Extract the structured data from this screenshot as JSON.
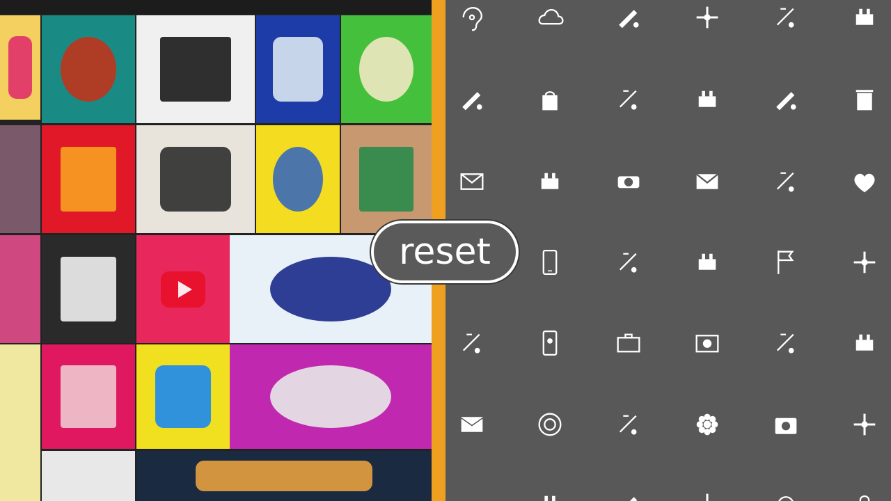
{
  "reset_button": {
    "label": "reset"
  },
  "collage": {
    "tiles": [
      {
        "name": "collage-tile-pink-bars",
        "bg": "#f4d060",
        "accent": "#e0306a"
      },
      {
        "name": "collage-tile-teal-device",
        "bg": "#1a8a84",
        "accent": "#c0341c"
      },
      {
        "name": "collage-tile-tea-cup",
        "bg": "#f0f0f0",
        "accent": "#1a1a1a"
      },
      {
        "name": "collage-tile-blue-box",
        "bg": "#1e3ca8",
        "accent": "#d8e6f0"
      },
      {
        "name": "collage-tile-green-box",
        "bg": "#44c03c",
        "accent": "#f0e8c0"
      },
      {
        "name": "collage-tile-red-package",
        "bg": "#e01828",
        "accent": "#f8a020"
      },
      {
        "name": "collage-tile-sketch",
        "bg": "#e8e4dc",
        "accent": "#2e2e2e"
      },
      {
        "name": "collage-tile-yellow-vase",
        "bg": "#f4dc20",
        "accent": "#3a6ab8"
      },
      {
        "name": "collage-tile-ornate-figure",
        "bg": "#c89870",
        "accent": "#2a8a4a"
      },
      {
        "name": "collage-tile-youtube-logo",
        "bg": "#e8285c",
        "accent": "#ffffff"
      },
      {
        "name": "collage-tile-poster-text",
        "bg": "#e8f0f8",
        "accent": "#1a2a8a"
      },
      {
        "name": "collage-tile-dark-bag",
        "bg": "#2a2a2a",
        "accent": "#f0f0f0"
      },
      {
        "name": "collage-tile-yellow-drop",
        "bg": "#f0e020",
        "accent": "#1a8af0"
      },
      {
        "name": "collage-tile-magenta-machine",
        "bg": "#c028b0",
        "accent": "#e8e8e8"
      },
      {
        "name": "collage-tile-red-pink-items",
        "bg": "#e01860",
        "accent": "#f0c8d0"
      },
      {
        "name": "collage-tile-bottom-strip",
        "bg": "#1a2a40",
        "accent": "#e8a040"
      }
    ]
  },
  "icons": [
    "ear-icon",
    "cloud-icon",
    "tools-icon",
    "ornament-icon",
    "battery-pack-icon",
    "tool-cross-icon",
    "sunrise-icon",
    "shopping-bag-icon",
    "pickaxe-icon",
    "tools-pair-icon",
    "coffee-mug-icon",
    "bin-icon",
    "envelope-outline-icon",
    "factory-icon",
    "tape-icon",
    "envelope-filled-icon",
    "crane-icon",
    "heart-icon",
    "settings-icon",
    "smartphone-icon",
    "cup-icon",
    "fence-icon",
    "flag-icon",
    "eraser-icon",
    "kettle-icon",
    "phone-card-icon",
    "briefcase-icon",
    "camera-frame-icon",
    "drill-icon",
    "hammer-icon",
    "envelope-card-icon",
    "target-button-icon",
    "bicycle-icon",
    "flower-icon",
    "camera-icon",
    "watering-can-icon",
    "circle-icon",
    "pointer-icon",
    "bars-icon",
    "link-icon",
    "at-icon",
    "lock-icon"
  ]
}
